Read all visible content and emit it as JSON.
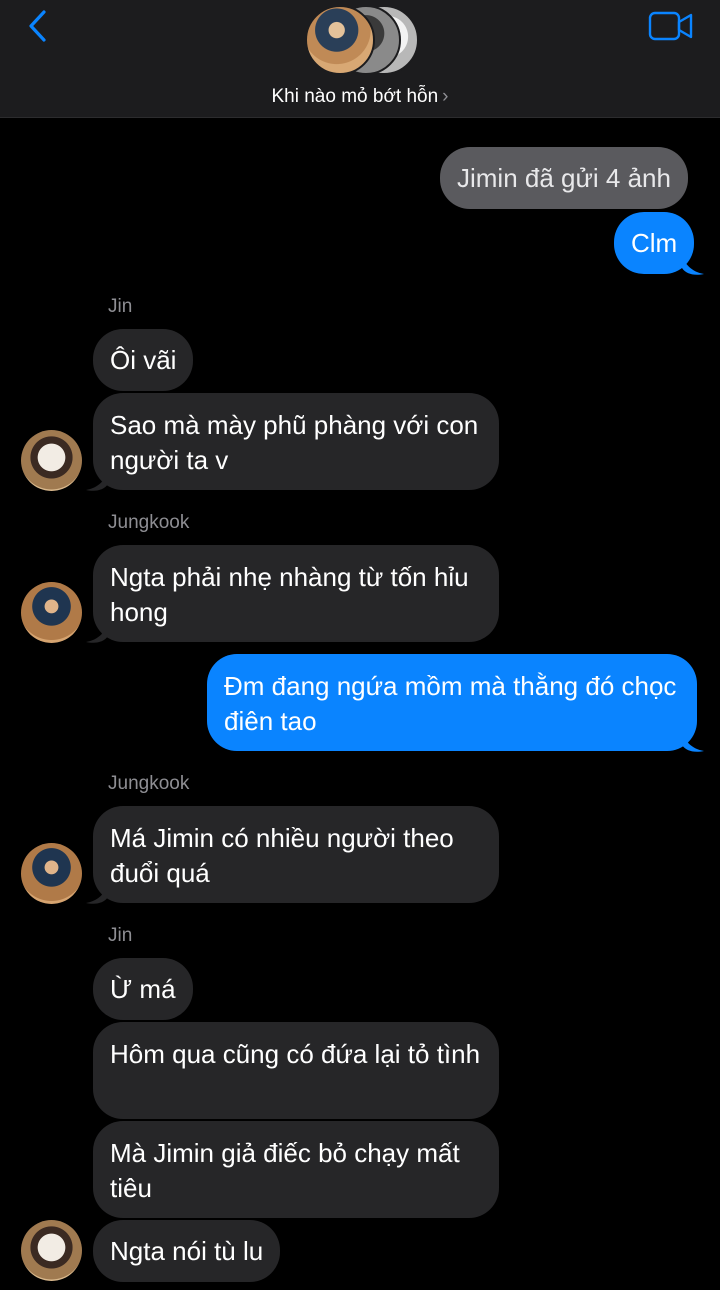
{
  "header": {
    "group_name": "Khi nào mỏ bớt hỗn",
    "chevron": "›",
    "back_icon": "back-chevron-icon",
    "video_icon": "video-camera-icon",
    "accent": "#0a84ff"
  },
  "messages": [
    {
      "type": "system",
      "text": "Jimin đã gửi 4 ảnh"
    },
    {
      "type": "out",
      "text": "Clm"
    },
    {
      "type": "sender",
      "text": "Jin"
    },
    {
      "type": "in",
      "text": "Ôi vãi"
    },
    {
      "type": "in",
      "text": "Sao mà mày phũ phàng với con người ta v"
    },
    {
      "type": "sender",
      "text": "Jungkook"
    },
    {
      "type": "in",
      "text": "Ngta phải nhẹ nhàng từ tốn hỉu hong"
    },
    {
      "type": "out",
      "text": "Đm đang ngứa mồm mà thằng đó chọc điên tao"
    },
    {
      "type": "sender",
      "text": "Jungkook"
    },
    {
      "type": "in",
      "text": "Má Jimin có nhiều người theo đuổi quá"
    },
    {
      "type": "sender",
      "text": "Jin"
    },
    {
      "type": "in",
      "text": "Ừ má"
    },
    {
      "type": "in",
      "text": "Hôm qua cũng có đứa lại  tỏ tình"
    },
    {
      "type": "in",
      "text": "Mà Jimin giả điếc bỏ chạy mất tiêu"
    },
    {
      "type": "in",
      "text": "Ngta nói tù lu"
    }
  ]
}
